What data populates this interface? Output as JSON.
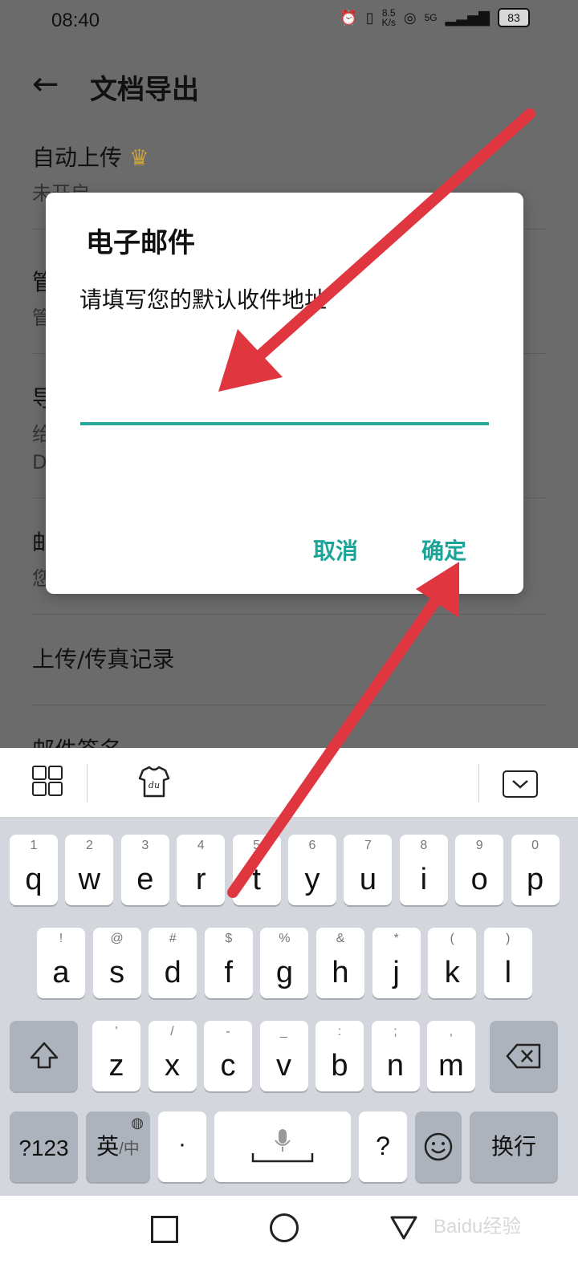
{
  "status_bar": {
    "time": "08:40",
    "net_speed_top": "8.5",
    "net_speed_bottom": "K/s",
    "signal_label": "5G",
    "battery": "83"
  },
  "app_bar": {
    "title": "文档导出"
  },
  "settings": [
    {
      "title": "自动上传",
      "subtitle": "未开启"
    },
    {
      "title": "管",
      "subtitle": "管"
    },
    {
      "title": "导",
      "subtitle": "给",
      "subtitle2": "D"
    },
    {
      "title": "邮",
      "subtitle": "您"
    },
    {
      "title": "上传/传真记录",
      "subtitle": ""
    },
    {
      "title": "邮件签名",
      "subtitle": ""
    }
  ],
  "dialog": {
    "title": "电子邮件",
    "message": "请填写您的默认收件地址",
    "input_value": "",
    "cancel_label": "取消",
    "ok_label": "确定"
  },
  "keyboard": {
    "row1": [
      {
        "num": "1",
        "letter": "q"
      },
      {
        "num": "2",
        "letter": "w"
      },
      {
        "num": "3",
        "letter": "e"
      },
      {
        "num": "4",
        "letter": "r"
      },
      {
        "num": "5",
        "letter": "t"
      },
      {
        "num": "6",
        "letter": "y"
      },
      {
        "num": "7",
        "letter": "u"
      },
      {
        "num": "8",
        "letter": "i"
      },
      {
        "num": "9",
        "letter": "o"
      },
      {
        "num": "0",
        "letter": "p"
      }
    ],
    "row2": [
      {
        "num": "!",
        "letter": "a"
      },
      {
        "num": "@",
        "letter": "s"
      },
      {
        "num": "#",
        "letter": "d"
      },
      {
        "num": "$",
        "letter": "f"
      },
      {
        "num": "%",
        "letter": "g"
      },
      {
        "num": "&",
        "letter": "h"
      },
      {
        "num": "*",
        "letter": "j"
      },
      {
        "num": "(",
        "letter": "k"
      },
      {
        "num": ")",
        "letter": "l"
      }
    ],
    "row3": [
      {
        "num": "'",
        "letter": "z"
      },
      {
        "num": "/",
        "letter": "x"
      },
      {
        "num": "-",
        "letter": "c"
      },
      {
        "num": "_",
        "letter": "v"
      },
      {
        "num": ":",
        "letter": "b"
      },
      {
        "num": ";",
        "letter": "n"
      },
      {
        "num": ",",
        "letter": "m"
      }
    ],
    "numbers_key": "?123",
    "lang_key_main": "英",
    "lang_key_sub": "/中",
    "period_key": "·",
    "question_key": "?",
    "enter_key": "换行",
    "colors": {
      "background": "#d3d6dc",
      "key": "#ffffff",
      "func_key": "#adb3bc",
      "accent": "#1aa598",
      "arrow": "#e0363f"
    }
  },
  "watermark": "Baidu经验"
}
